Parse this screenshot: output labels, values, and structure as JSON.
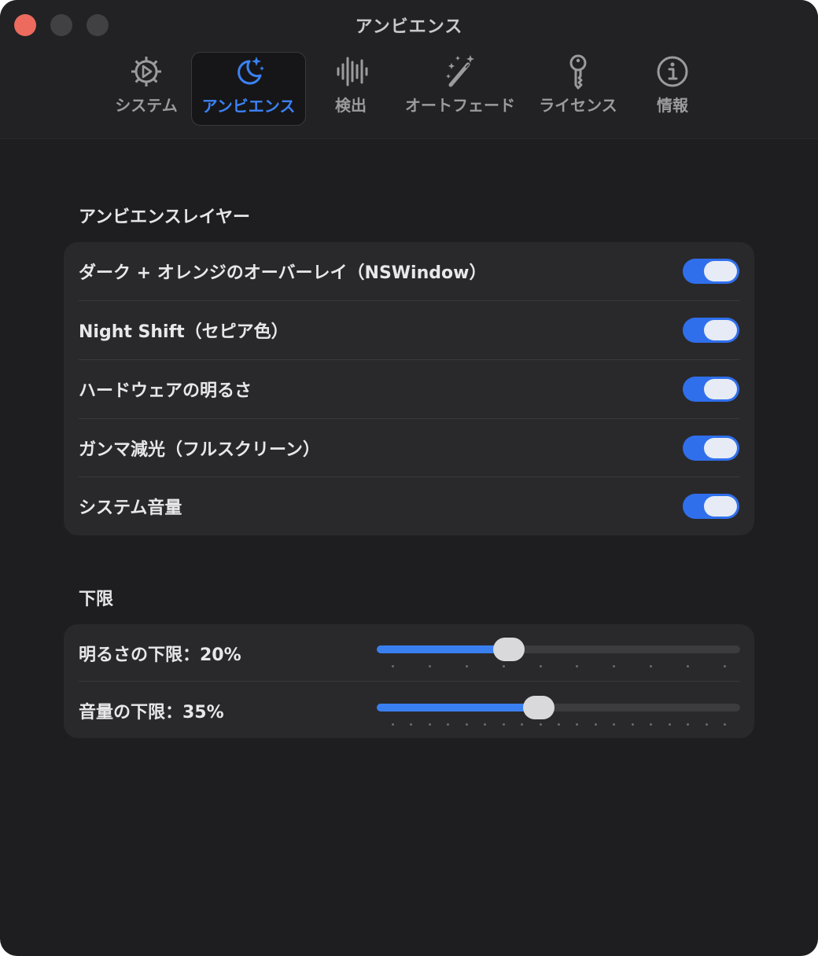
{
  "window": {
    "title": "アンビエンス"
  },
  "tabs": [
    {
      "label": "システム",
      "icon": "gear-play-icon",
      "active": false
    },
    {
      "label": "アンビエンス",
      "icon": "moon-stars-icon",
      "active": true
    },
    {
      "label": "検出",
      "icon": "waveform-icon",
      "active": false
    },
    {
      "label": "オートフェード",
      "icon": "magic-wand-icon",
      "active": false
    },
    {
      "label": "ライセンス",
      "icon": "key-icon",
      "active": false
    },
    {
      "label": "情報",
      "icon": "info-circle-icon",
      "active": false
    }
  ],
  "layers": {
    "title": "アンビエンスレイヤー",
    "items": [
      {
        "label": "ダーク + オレンジのオーバーレイ（NSWindow）",
        "on": true
      },
      {
        "label": "Night Shift（セピア色）",
        "on": true
      },
      {
        "label": "ハードウェアの明るさ",
        "on": true
      },
      {
        "label": "ガンマ減光（フルスクリーン）",
        "on": true
      },
      {
        "label": "システム音量",
        "on": true
      }
    ]
  },
  "limits": {
    "title": "下限",
    "items": [
      {
        "label": "明るさの下限：20%",
        "value": 0.35,
        "ticks": 10
      },
      {
        "label": "音量の下限：35%",
        "value": 0.44,
        "ticks": 19
      }
    ]
  },
  "colors": {
    "accent": "#3b82f6",
    "toggle_on": "#2f6fec",
    "close": "#ed6a5e"
  }
}
